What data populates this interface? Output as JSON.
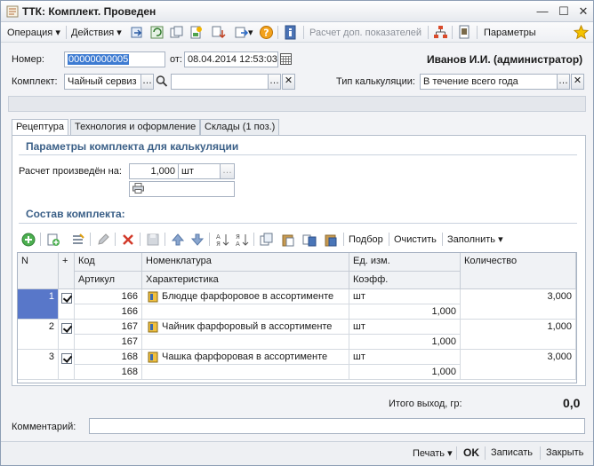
{
  "window": {
    "title": "ТТК: Комплект. Проведен",
    "controls": {
      "minimize": "—",
      "maximize": "☐",
      "close": "✕"
    }
  },
  "toolbar": {
    "operation": "Операция",
    "actions": "Действия",
    "calc_indicators": "Расчет доп. показателей",
    "parameters": "Параметры"
  },
  "header": {
    "number_label": "Номер:",
    "number_value": "00000000005",
    "date_label": "от:",
    "date_value": "08.04.2014 12:53:03",
    "user": "Иванов И.И. (администратор)",
    "kit_label": "Комплект:",
    "kit_value": "Чайный сервиз",
    "kit_extra_value": "",
    "calc_type_label": "Тип калькуляции:",
    "calc_type_value": "В течение всего года"
  },
  "tabs": [
    {
      "label": "Рецептура"
    },
    {
      "label": "Технология и оформление"
    },
    {
      "label": "Склады (1 поз.)"
    }
  ],
  "params": {
    "section_title": "Параметры комплекта для калькуляции",
    "calc_label": "Расчет произведён на:",
    "quantity": "1,000",
    "unit": "шт"
  },
  "composition": {
    "section_title": "Состав комплекта:",
    "select_btn": "Подбор",
    "clear_btn": "Очистить",
    "fill_btn": "Заполнить"
  },
  "table": {
    "headers": {
      "n": "N",
      "plus": "+",
      "code": "Код",
      "article": "Артикул",
      "nomenclature": "Номенклатура",
      "characteristic": "Характеристика",
      "unit": "Ед. изм.",
      "coef": "Коэфф.",
      "quantity": "Количество"
    },
    "rows": [
      {
        "n": "1",
        "code": "166",
        "article": "166",
        "name": "Блюдце фарфоровое в ассортименте",
        "unit": "шт",
        "coef": "1,000",
        "qty": "3,000"
      },
      {
        "n": "2",
        "code": "167",
        "article": "167",
        "name": "Чайник фарфоровый в ассортименте",
        "unit": "шт",
        "coef": "1,000",
        "qty": "1,000"
      },
      {
        "n": "3",
        "code": "168",
        "article": "168",
        "name": "Чашка фарфоровая в ассортименте",
        "unit": "шт",
        "coef": "1,000",
        "qty": "3,000"
      }
    ]
  },
  "footer": {
    "total_label": "Итого выход, гр:",
    "total_value": "0,0",
    "comment_label": "Комментарий:",
    "comment_value": ""
  },
  "bottom": {
    "print": "Печать",
    "ok": "OK",
    "save": "Записать",
    "close": "Закрыть"
  },
  "colors": {
    "accent": "#3d7bd2",
    "section": "#3a5f87",
    "selected_row": "#5877c9"
  }
}
